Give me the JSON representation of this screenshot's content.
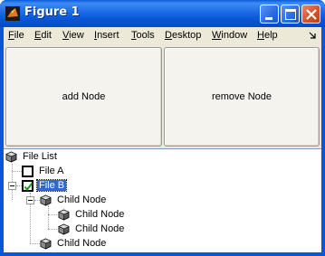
{
  "window": {
    "title": "Figure 1",
    "controls": [
      "minimize-icon",
      "maximize-icon",
      "close-icon"
    ]
  },
  "menu": {
    "items": [
      "File",
      "Edit",
      "View",
      "Insert",
      "Tools",
      "Desktop",
      "Window",
      "Help"
    ]
  },
  "buttons": {
    "add": "add Node",
    "remove": "remove Node"
  },
  "tree": {
    "root": "File List",
    "file_a": "File A",
    "file_b": "File B",
    "file_a_checked": false,
    "file_b_checked": true,
    "file_b_selected": true,
    "child_node_1": "Child Node",
    "grandchild_1": "Child Node",
    "grandchild_2": "Child Node",
    "child_node_2": "Child Node"
  },
  "colors": {
    "selection": "#316ac5",
    "titlebar": "#0a56d8",
    "face": "#ece9d8"
  }
}
